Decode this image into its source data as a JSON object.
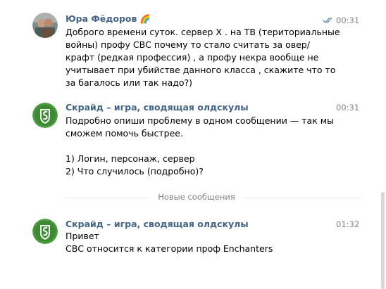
{
  "messages": [
    {
      "author": "Юра Фёдоров",
      "author_emoji": "🌈",
      "time": "00:31",
      "status_icon": "double-check-icon",
      "text": "Доброго времени суток. сервер Х . на ТВ (териториальные\nвойны) профу СВС почему то стало считать за овер/\nкрафт (редкая профессия) , а профу некра вообще не\nучитывает при убийстве данного класса , скажите что то\nза багалось или так надо?)"
    },
    {
      "author": "Скрайд – игра, сводящая олдскулы",
      "time": "00:31",
      "text": "Подробно опиши проблему в одном сообщении — так мы\nсможем помочь быстрее.\n\n1) Логин, персонаж, сервер\n2) Что случилось (подробно)?"
    },
    {
      "author": "Скрайд – игра, сводящая олдскулы",
      "time": "01:32",
      "text": "Привет\nСВС относится к категории проф Enchanters"
    }
  ],
  "divider": {
    "label": "Новые сообщения"
  },
  "colors": {
    "author": "#42648b",
    "time": "#828282",
    "read_check": "#5181b8",
    "divider_line": "#e7e8ec",
    "scrollbar": "#d3d9de",
    "group_avatar_bg": "#4a9d3f"
  }
}
